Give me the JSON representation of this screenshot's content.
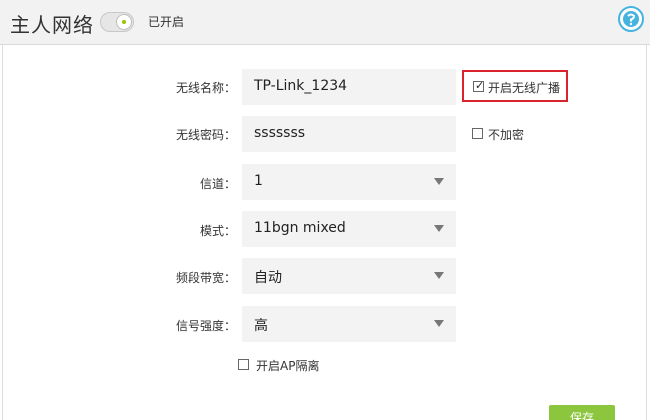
{
  "header": {
    "title": "主人网络",
    "toggle_status": "已开启"
  },
  "form": {
    "ssid": {
      "label": "无线名称：",
      "value": "TP-Link_1234"
    },
    "password": {
      "label": "无线密码：",
      "value": "sssssss"
    },
    "channel": {
      "label": "信道：",
      "value": "1"
    },
    "mode": {
      "label": "模式：",
      "value": "11bgn mixed"
    },
    "bandwidth": {
      "label": "频段带宽：",
      "value": "自动"
    },
    "signal_strength": {
      "label": "信号强度：",
      "value": "高"
    }
  },
  "options": {
    "broadcast": {
      "label": "开启无线广播",
      "checked": true
    },
    "no_encryption": {
      "label": "不加密",
      "checked": false
    },
    "ap_isolation": {
      "label": "开启AP隔离",
      "checked": false
    }
  },
  "save_button": {
    "label": "保存"
  },
  "colors": {
    "accent_green": "#8cc63f",
    "highlight_red": "#d9232d"
  },
  "icons": {
    "help": "help-icon",
    "dropdown": "chevron-down-icon"
  }
}
